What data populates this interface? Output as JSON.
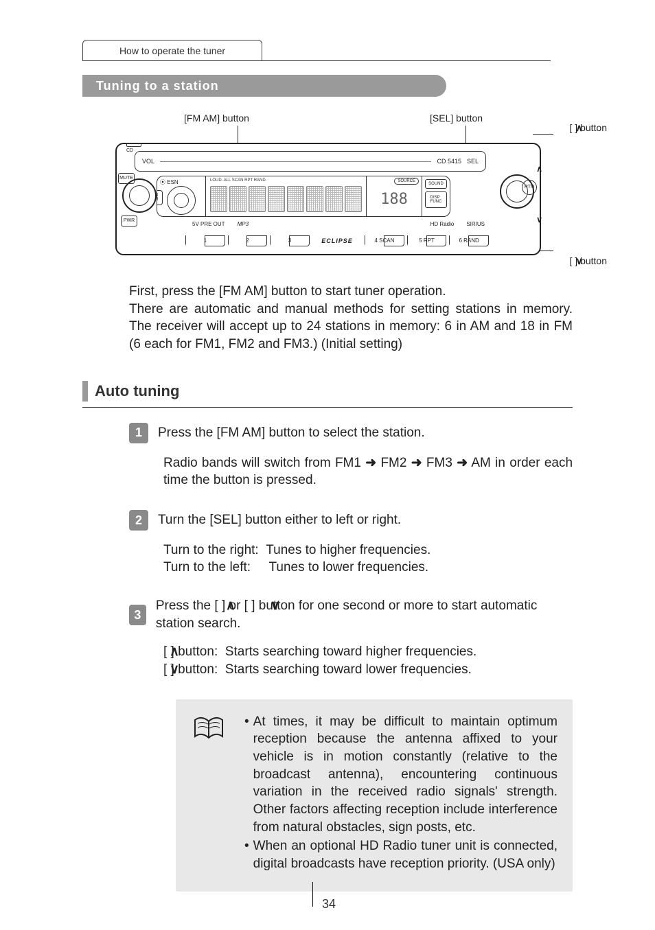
{
  "header": {
    "tab_label": "How to operate the tuner",
    "section_title": "Tuning to a station"
  },
  "device": {
    "model": "CD 5415",
    "vol": "VOL",
    "sel": "SEL",
    "cd": "CD",
    "mute": "MUTE",
    "pwr": "PWR",
    "esn": "ESN",
    "fm_am": "FM\nAM",
    "rtn": "RTN",
    "disp_func": "DISP\nFUNC",
    "sound": "SOUND",
    "source": "SOURCE",
    "tags": "LOUD. ALL SCAN RPT RAND.",
    "digits": "188",
    "preout": "5V PRE OUT",
    "mp3": "MP3",
    "hd": "HD Radio",
    "sirius": "SIRIUS",
    "brand": "ECLIPSE",
    "presets": [
      "1",
      "2",
      "3",
      "4  SCAN",
      "5  RPT",
      "6  RAND"
    ]
  },
  "callouts": {
    "sel": "[SEL] button",
    "fmam": "[FM AM] button",
    "tune_up": "[    ] button",
    "tune_down": "[    ] button"
  },
  "intro": {
    "line1": "First, press the [FM AM] button to start tuner operation.",
    "line2": "There are automatic and manual methods for setting stations in memory.  The receiver will accept up to 24 stations in memory: 6 in AM and 18 in FM (6 each for FM1, FM2 and FM3.) (Initial setting)"
  },
  "subsection_title": "Auto tuning",
  "steps": {
    "s1": {
      "num": "1",
      "title": "Press the [FM AM] button to select the station.",
      "body_a": "Radio bands will switch from FM1 ",
      "body_b": " FM2 ",
      "body_c": " FM3 ",
      "body_d": " AM in order each time the button is pressed."
    },
    "s2": {
      "num": "2",
      "title": "Turn the [SEL] button either to left or right.",
      "right_label": "Turn to the right:",
      "right_val": "Tunes to higher frequencies.",
      "left_label": "Turn to the left:",
      "left_val": "Tunes to lower frequencies."
    },
    "s3": {
      "num": "3",
      "title_a": "Press the [   ] or [   ] button for one second or more to start automatic station search.",
      "up_label": "[    ] button:",
      "up_val": "Starts searching toward higher frequencies.",
      "down_label": "[    ] button:",
      "down_val": "Starts searching toward lower frequencies."
    }
  },
  "note": {
    "b1": "At times, it may be difficult to maintain optimum reception because the antenna affixed to your vehicle is in motion constantly (relative to the broadcast antenna), encountering continuous variation in the received radio signals' strength. Other factors affecting reception include interference from natural obstacles, sign posts, etc.",
    "b2": "When an optional HD Radio tuner unit is connected, digital broadcasts have reception priority. (USA only)"
  },
  "page_number": "34"
}
